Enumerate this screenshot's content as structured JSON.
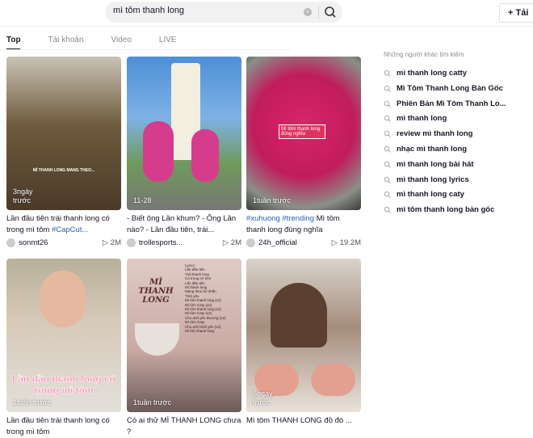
{
  "search": {
    "value": "mì tôm thanh long"
  },
  "upload_label": "+ Tải",
  "tabs": [
    "Top",
    "Tài khoản",
    "Video",
    "LIVE"
  ],
  "videos": [
    {
      "time": "3ngày trước",
      "desc": "Lần đầu tiên trái thanh long có trong mì tôm ",
      "tags": "#CapCut...",
      "author": "sonmt26",
      "views": "2M",
      "thumb_text": "MÌ THANH LONG MANG THEO...",
      "bg": "linear-gradient(180deg,#c9c3b4 0%,#6e5a3c 45%,#4a3a28 100%)"
    },
    {
      "time": "11-28",
      "desc": "- Biết ông Lần khum? - Ông Lần nào? - Lần đầu tiên, trái...",
      "tags": "",
      "author": "trollesports...",
      "views": "2M",
      "thumb_text": "",
      "bg": "linear-gradient(180deg,#4d8fd6 0%,#7fb2e6 40%,#6f9a5a 70%,#777 100%)"
    },
    {
      "time": "1tuần trước",
      "desc": " Mì tôm thanh long đúng nghĩa",
      "tags": "#xuhuong #trending",
      "author": "24h_official",
      "views": "19.2M",
      "thumb_text": "Mì tôm thanh long đúng nghĩa",
      "bg": "radial-gradient(circle at 50% 45%,#d8246a 0%,#c01d5c 50%,#8a8f88 80%,#3b3d3a 100%)"
    },
    {
      "time": "1tuần trước",
      "desc": "Lần đầu tiên trái thanh long có trong mì tôm",
      "tags": "",
      "author": "",
      "views": "",
      "thumb_text": "Lần đầu thanh long có trong mì tôm",
      "bg": "linear-gradient(180deg,#b7b09a 0%,#d6c9b7 40%,#e3e0da 100%)"
    },
    {
      "time": "1tuần trước",
      "desc": "Có ai thử MÌ THANH LONG chưa ?",
      "tags": "",
      "author": "",
      "views": "",
      "thumb_text": "MÌ THANH LONG",
      "bg": "linear-gradient(180deg,#dfcbc6 0%,#c9a9a3 60%,#6b5a58 100%)"
    },
    {
      "time": "6ngày trước",
      "desc": "Mì tôm THANH LONG đồ đó ...",
      "tags": "",
      "author": "",
      "views": "",
      "thumb_text": "",
      "bg": "linear-gradient(180deg,#d9d3cc 0%,#a58d7c 45%,#e8e2db 100%)"
    }
  ],
  "lyrics": [
    "Lyrics:",
    "Lần đầu tiên",
    "Trái thanh long",
    "Có trong mì tôm",
    "Lần đầu tiên",
    "Mì thanh long",
    "Mang theo lời nhắn",
    "Tình yêu",
    "Mì tôm thanh long (x2)",
    "Mì tôm Caty (x2)",
    "Mì tôm thanh long (x2)",
    "Mì tôm Caty (x2)",
    "Cho anh yêu thương (x2)",
    "Mì tôm Caty",
    "Cho anh bình yên (x2)",
    "Mì tôm thanh long"
  ],
  "sidebar": {
    "title": "Những người khác tìm kiếm",
    "items": [
      "mì thanh long catty",
      "Mì Tôm Thanh Long Bản Gốc",
      "Phiên Bản Mì Tôm Thanh Lo...",
      "mì thanh long",
      "review mì thanh long",
      "nhạc mì thanh long",
      "mì thanh long bài hát",
      "mì thanh long lyrics",
      "mì thanh long caty",
      "mì tôm thanh long bản gốc"
    ]
  },
  "icons": {
    "search": "search-icon",
    "clear": "clear-icon",
    "play": "play-icon",
    "plus": "plus-icon"
  },
  "colors": {
    "hashtag": "#2b5db9",
    "text": "#161823",
    "muted": "#8a8b91"
  }
}
